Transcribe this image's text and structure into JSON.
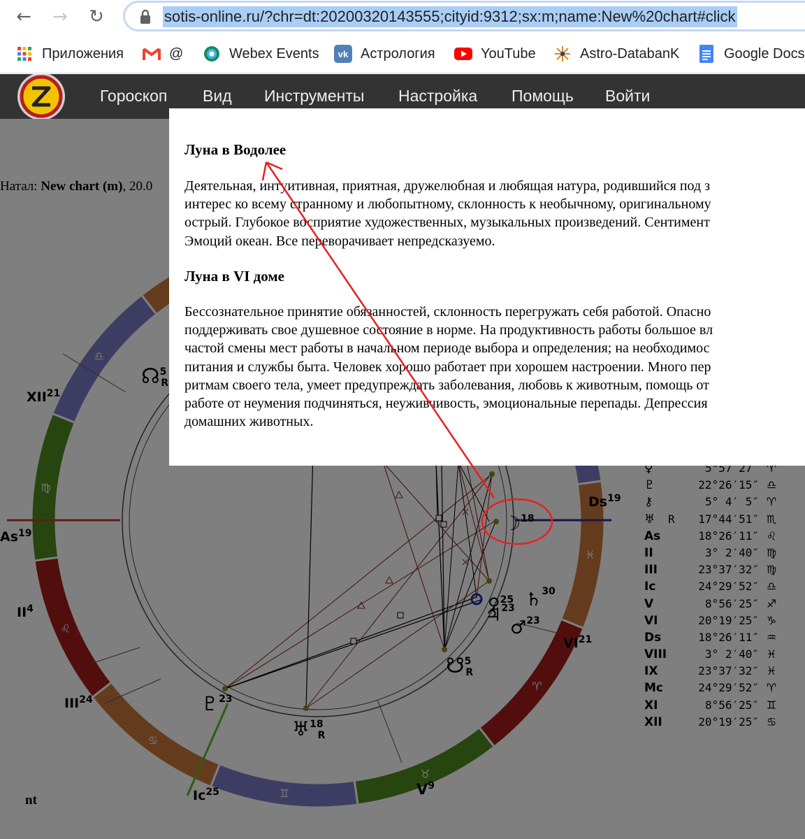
{
  "browser": {
    "url": "sotis-online.ru/?chr=dt:20200320143555;cityid:9312;sx:m;name:New%20chart#click",
    "bookmarks": [
      {
        "label": "Приложения",
        "icon": "apps-grid-icon"
      },
      {
        "label": "@",
        "icon": "gmail-icon"
      },
      {
        "label": "Webex Events",
        "icon": "webex-icon"
      },
      {
        "label": "Астрология",
        "icon": "vk-icon"
      },
      {
        "label": "YouTube",
        "icon": "youtube-icon"
      },
      {
        "label": "Astro-DatabanK",
        "icon": "astro-databank-icon"
      },
      {
        "label": "Google Docs",
        "icon": "google-docs-icon"
      }
    ]
  },
  "site": {
    "nav": [
      "Гороскоп",
      "Вид",
      "Инструменты",
      "Настройка",
      "Помощь",
      "Войти"
    ],
    "info": {
      "prefix": "Натал: ",
      "name": "New chart (m)",
      "rest": ", 20.0"
    },
    "footer_fragment": "nt"
  },
  "chart": {
    "houses": [
      {
        "label": "XII",
        "deg": "21"
      },
      {
        "label": "As",
        "deg": "19"
      },
      {
        "label": "II",
        "deg": "4"
      },
      {
        "label": "III",
        "deg": "24"
      },
      {
        "label": "Ic",
        "deg": "25"
      },
      {
        "label": "V",
        "deg": "9"
      },
      {
        "label": "VI",
        "deg": "21"
      },
      {
        "label": "Ds",
        "deg": "19"
      }
    ],
    "planets_on_wheel": [
      {
        "name": "north-node",
        "glyph": "☊",
        "deg": "5",
        "retro": "R"
      },
      {
        "name": "moon",
        "glyph": "☽",
        "deg": "18",
        "retro": ""
      },
      {
        "name": "venus",
        "glyph": "♀",
        "deg": "25",
        "retro": ""
      },
      {
        "name": "saturn",
        "glyph": "♄",
        "deg": "30",
        "retro": ""
      },
      {
        "name": "jupiter",
        "glyph": "♃",
        "deg": "23",
        "retro": ""
      },
      {
        "name": "mars",
        "glyph": "♂",
        "deg": "23",
        "retro": ""
      },
      {
        "name": "south-node",
        "glyph": "☋",
        "deg": "5",
        "retro": "R"
      },
      {
        "name": "pluto",
        "glyph": "♇",
        "deg": "23",
        "retro": ""
      },
      {
        "name": "uranus",
        "glyph": "♅",
        "deg": "18",
        "retro": "R"
      }
    ],
    "ring_colors": {
      "fire": "#a41b1b",
      "earth": "#4e8b1e",
      "air": "#7a7ac8",
      "water": "#c8793a"
    }
  },
  "positions": [
    {
      "sym": "♀",
      "retro": "",
      "pos": "5°57′27″",
      "sign": "♈"
    },
    {
      "sym": "♇",
      "retro": "",
      "pos": "22°26′15″",
      "sign": "♎"
    },
    {
      "sym": "⚷",
      "retro": "",
      "pos": "5° 4′ 5″",
      "sign": "♈"
    },
    {
      "sym": "♅",
      "retro": "R",
      "pos": "17°44′51″",
      "sign": "♏"
    },
    {
      "sym": "As",
      "retro": "",
      "pos": "18°26′11″",
      "sign": "♌"
    },
    {
      "sym": "II",
      "retro": "",
      "pos": "3° 2′40″",
      "sign": "♍"
    },
    {
      "sym": "III",
      "retro": "",
      "pos": "23°37′32″",
      "sign": "♍"
    },
    {
      "sym": "Ic",
      "retro": "",
      "pos": "24°29′52″",
      "sign": "♎"
    },
    {
      "sym": "V",
      "retro": "",
      "pos": "8°56′25″",
      "sign": "♐"
    },
    {
      "sym": "VI",
      "retro": "",
      "pos": "20°19′25″",
      "sign": "♑"
    },
    {
      "sym": "Ds",
      "retro": "",
      "pos": "18°26′11″",
      "sign": "♒"
    },
    {
      "sym": "VIII",
      "retro": "",
      "pos": "3° 2′40″",
      "sign": "♓"
    },
    {
      "sym": "IX",
      "retro": "",
      "pos": "23°37′32″",
      "sign": "♓"
    },
    {
      "sym": "Mc",
      "retro": "",
      "pos": "24°29′52″",
      "sign": "♈"
    },
    {
      "sym": "XI",
      "retro": "",
      "pos": "8°56′25″",
      "sign": "♊"
    },
    {
      "sym": "XII",
      "retro": "",
      "pos": "20°19′25″",
      "sign": "♋"
    }
  ],
  "popup": {
    "h1": "Луна в Водолее",
    "p1": [
      "Деятельная, интуитивная, приятная, дружелюбная и любящая натура, родившийся под з",
      "интерес ко всему странному и любопытному, склонность к необычному, оригинальному",
      "острый. Глубокое восприятие художественных, музыкальных произведений. Сентимент",
      "Эмоций океан. Все переворачивает непредсказуемо."
    ],
    "h2": "Луна в VI доме",
    "p2": [
      "Бессознательное принятие обязанностей, склонность перегружать себя работой. Опасно",
      "поддерживать свое душевное состояние в норме. На продуктивность работы большое вл",
      "частой смены мест работы в начальном периоде выбора и определения; на необходимос",
      "питания и службы быта. Человек хорошо работает при хорошем настроении. Много пер",
      "ритмам своего тела, умеет предупреждать заболевания, любовь к животным, помощь от",
      "работе от неумения подчиняться, неуживчивость, эмоциональные перепады. Депрессия",
      "домашних животных."
    ]
  }
}
